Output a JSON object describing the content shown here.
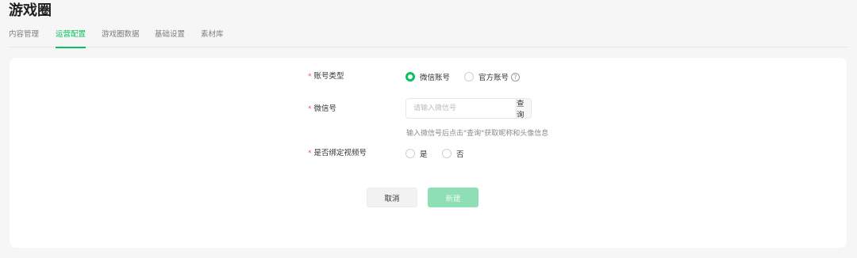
{
  "page": {
    "title": "游戏圈"
  },
  "tabs": [
    {
      "label": "内容管理",
      "active": false
    },
    {
      "label": "运营配置",
      "active": true
    },
    {
      "label": "游戏圈数据",
      "active": false
    },
    {
      "label": "基础设置",
      "active": false
    },
    {
      "label": "素材库",
      "active": false
    }
  ],
  "form": {
    "required_mark": "*",
    "account_type": {
      "label": "账号类型",
      "options": [
        {
          "label": "微信账号",
          "checked": true
        },
        {
          "label": "官方账号",
          "checked": false,
          "help_icon": "question-circle-icon",
          "help_glyph": "?"
        }
      ]
    },
    "wechat_id": {
      "label": "微信号",
      "placeholder": "请输入微信号",
      "value": "",
      "query_button": "查询",
      "hint": "输入微信号后点击\"查询\"获取昵称和头像信息"
    },
    "bind_channel": {
      "label": "是否绑定视频号",
      "options": [
        {
          "label": "是",
          "checked": false
        },
        {
          "label": "否",
          "checked": false
        }
      ]
    }
  },
  "actions": {
    "cancel": "取消",
    "create": "新建",
    "create_disabled": true
  },
  "colors": {
    "accent": "#07c160",
    "required": "#fa5151",
    "background": "#f6f6f6",
    "card": "#ffffff"
  }
}
